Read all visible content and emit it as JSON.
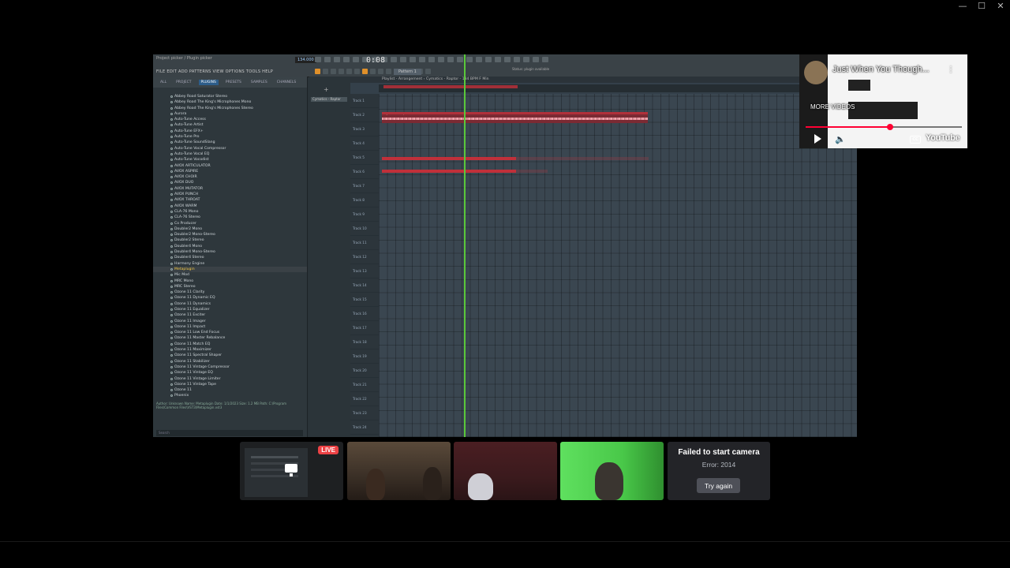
{
  "window": {
    "minimize": "—",
    "maximize": "☐",
    "close": "✕"
  },
  "daw": {
    "title_line": "Cymatics - Raptor",
    "hint_line": "Project picker / Plugin picker",
    "menu": "FILE  EDIT  ADD  PATTERNS  VIEW  OPTIONS  TOOLS  HELP",
    "time": "0:08",
    "time_sub": "12",
    "tempo": "134.000",
    "pattern": "Pattern 1",
    "hint": "Status: plugin available",
    "browser_tabs": [
      "ALL",
      "PROJECT",
      "PLUGINS",
      "PRESETS",
      "SAMPLES",
      "CHANNELS"
    ],
    "browser_active_tab": 2,
    "plugins": [
      "Abbey Road Saturator Stereo",
      "Abbey Road The King's Microphones Mono",
      "Abbey Road The King's Microphones Stereo",
      "Aurora",
      "Auto-Tune Access",
      "Auto-Tune Artist",
      "Auto-Tune EFX+",
      "Auto-Tune Pro",
      "Auto-Tune SoundSlang",
      "Auto-Tune Vocal Compressor",
      "Auto-Tune Vocal EQ",
      "Auto-Tune Vocodist",
      "AVOX ARTICULATOR",
      "AVOX ASPIRE",
      "AVOX CHOIR",
      "AVOX DUO",
      "AVOX MUTATOR",
      "AVOX PUNCH",
      "AVOX THROAT",
      "AVOX WARM",
      "CLA-76 Mono",
      "CLA-76 Stereo",
      "Co Producer",
      "Doubler2 Mono",
      "Doubler2 Mono-Stereo",
      "Doubler2 Stereo",
      "Doubler4 Mono",
      "Doubler4 Mono-Stereo",
      "Doubler4 Stereo",
      "Harmony Engine",
      "Metaplugin",
      "Mic Mod",
      "MRC Mono",
      "MRC Stereo",
      "Ozone 11 Clarity",
      "Ozone 11 Dynamic EQ",
      "Ozone 11 Dynamics",
      "Ozone 11 Equalizer",
      "Ozone 11 Exciter",
      "Ozone 11 Imager",
      "Ozone 11 Impact",
      "Ozone 11 Low End Focus",
      "Ozone 11 Master Rebalance",
      "Ozone 11 Match EQ",
      "Ozone 11 Maximizer",
      "Ozone 11 Spectral Shaper",
      "Ozone 11 Stabilizer",
      "Ozone 11 Vintage Compressor",
      "Ozone 11 Vintage EQ",
      "Ozone 11 Vintage Limiter",
      "Ozone 11 Vintage Tape",
      "Ozone 11",
      "Phoenix"
    ],
    "highlighted_plugin": 30,
    "browser_info": "Author: Unknown  Name: Metaplugin  Date: 1/1/2023  Size: 1.2 MB  Path: C:\\Program Files\\Common Files\\VST3\\Metaplugin.vst3",
    "browser_search": "Search",
    "channel_button": "Cymatics - Raptor",
    "playlist_title": "Playlist - Arrangement › Cymatics - Raptor - 134 BPM F Min",
    "track_names": [
      "Track 1",
      "Track 2",
      "Track 3",
      "Track 4",
      "Track 5",
      "Track 6",
      "Track 7",
      "Track 8",
      "Track 9",
      "Track 10",
      "Track 11",
      "Track 12",
      "Track 13",
      "Track 14",
      "Track 15",
      "Track 16",
      "Track 17",
      "Track 18",
      "Track 19",
      "Track 20",
      "Track 21",
      "Track 22",
      "Track 23",
      "Track 24"
    ],
    "audio_clip_label": "Cymatics - Raptor - 134 BPM F Min",
    "accent_playhead": "#5ac83a",
    "accent_clip": "#c0303a"
  },
  "youtube": {
    "title": "Just When You Though...",
    "menu_icon": "⋮",
    "more_videos": "MORE VIDEOS",
    "progress": 0.54,
    "volume_icon": "🔈",
    "cc": "CC",
    "logo": "YouTube"
  },
  "call": {
    "live_badge": "LIVE",
    "camera_error_title": "Failed to start camera",
    "camera_error_code": "Error: 2014",
    "retry_label": "Try again"
  }
}
